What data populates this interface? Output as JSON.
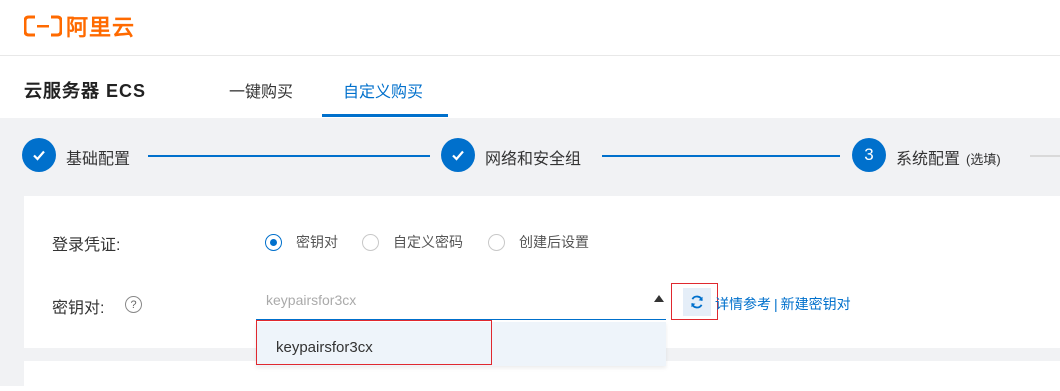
{
  "brand": {
    "logo_text": "阿里云",
    "accent": "#ff6a00"
  },
  "product": {
    "title": "云服务器 ECS"
  },
  "tabs": [
    {
      "label": "一键购买",
      "active": false
    },
    {
      "label": "自定义购买",
      "active": true
    }
  ],
  "steps": [
    {
      "label": "基础配置",
      "status": "done",
      "icon": "check-icon"
    },
    {
      "label": "网络和安全组",
      "status": "done",
      "icon": "check-icon"
    },
    {
      "number": "3",
      "label": "系统配置",
      "note": "(选填)",
      "status": "current"
    }
  ],
  "login": {
    "label": "登录凭证:",
    "options": [
      {
        "label": "密钥对",
        "checked": true
      },
      {
        "label": "自定义密码",
        "checked": false
      },
      {
        "label": "创建后设置",
        "checked": false
      }
    ]
  },
  "keypair": {
    "label": "密钥对:",
    "help": "?",
    "placeholder": "keypairsfor3cx",
    "details_link": "详情参考",
    "separator": "|",
    "create_link": "新建密钥对",
    "options": [
      "keypairsfor3cx"
    ]
  },
  "colors": {
    "primary": "#0070cc",
    "highlight": "#e0282e"
  }
}
